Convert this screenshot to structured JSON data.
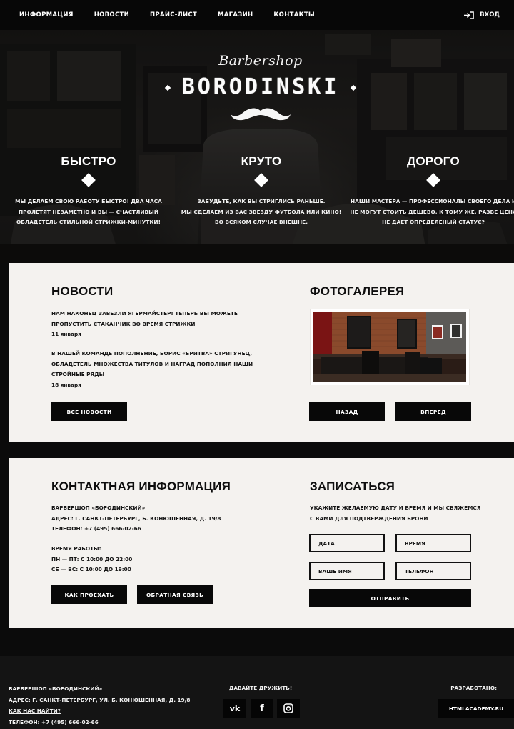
{
  "nav": {
    "items": [
      "ИНФОРМАЦИЯ",
      "НОВОСТИ",
      "ПРАЙС-ЛИСТ",
      "МАГАЗИН",
      "КОНТАКТЫ"
    ],
    "login_label": "ВХОД",
    "login_icon": "login-icon"
  },
  "logo": {
    "script": "Barbershop",
    "wordmark": "BORODINSKI",
    "icon": "mustache-icon"
  },
  "features": [
    {
      "title": "БЫСТРО",
      "lines": [
        "МЫ ДЕЛАЕМ СВОЮ РАБОТУ БЫСТРО! ДВА ЧАСА",
        "ПРОЛЕТЯТ НЕЗАМЕТНО И ВЫ — СЧАСТЛИВЫЙ",
        "ОБЛАДЕТЕЛЬ СТИЛЬНОЙ СТРИЖКИ-МИНУТКИ!"
      ]
    },
    {
      "title": "КРУТО",
      "lines": [
        "ЗАБУДЬТЕ, КАК ВЫ СТРИГЛИСЬ РАНЬШЕ.",
        "МЫ СДЕЛАЕМ ИЗ ВАС ЗВЕЗДУ ФУТБОЛА ИЛИ КИНО!",
        "ВО ВСЯКОМ СЛУЧАЕ ВНЕШНЕ."
      ]
    },
    {
      "title": "ДОРОГО",
      "lines": [
        "НАШИ МАСТЕРА — ПРОФЕССИОНАЛЫ СВОЕГО ДЕЛА И",
        "НЕ МОГУТ СТОИТЬ ДЕШЕВО. К ТОМУ ЖЕ, РАЗВЕ ЦЕНА",
        "НЕ ДАЕТ ОПРЕДЕЛЕНЫЙ СТАТУС?"
      ]
    }
  ],
  "news": {
    "title": "НОВОСТИ",
    "items": [
      {
        "lines": [
          "НАМ НАКОНЕЦ ЗАВЕЗЛИ ЯГЕРМАЙСТЕР! ТЕПЕРЬ ВЫ МОЖЕТЕ",
          "ПРОПУСТИТЬ СТАКАНЧИК ВО ВРЕМЯ СТРИЖКИ"
        ],
        "date": "11 января"
      },
      {
        "lines": [
          "В НАШЕЙ КОМАНДЕ ПОПОЛНЕНИЕ, БОРИС «БРИТВА» СТРИГУНЕЦ,",
          "ОБЛАДЕТЕЛЬ МНОЖЕСТВА ТИТУЛОВ И НАГРАД ПОПОЛНИЛ НАШИ",
          "СТРОЙНЫЕ РЯДЫ"
        ],
        "date": "18 января"
      }
    ],
    "all_button": "ВСЕ НОВОСТИ"
  },
  "gallery": {
    "title": "ФОТОГАЛЕРЕЯ",
    "prev_button": "НАЗАД",
    "next_button": "ВПЕРЕД"
  },
  "contacts": {
    "title": "КОНТАКТНАЯ ИНФОРМАЦИЯ",
    "lines": [
      "БАРБЕРШОП «БОРОДИНСКИЙ»",
      "АДРЕС: Г. САНКТ-ПЕТЕРБУРГ, Б. КОНЮШЕННАЯ, Д. 19/8",
      "ТЕЛЕФОН: +7 (495) 666-02-66"
    ],
    "hours_title": "ВРЕМЯ РАБОТЫ:",
    "hours": [
      "ПН — ПТ: С 10:00 ДО 22:00",
      "СБ — ВС: С 10:00 ДО 19:00"
    ],
    "route_button": "КАК ПРОЕХАТЬ",
    "feedback_button": "ОБРАТНАЯ СВЯЗЬ"
  },
  "booking": {
    "title": "ЗАПИСАТЬСЯ",
    "lines": [
      "УКАЖИТЕ ЖЕЛАЕМУЮ ДАТУ И ВРЕМЯ И МЫ СВЯЖЕМСЯ",
      "С ВАМИ ДЛЯ ПОДТВЕРЖДЕНИЯ БРОНИ"
    ],
    "date_placeholder": "ДАТА",
    "time_placeholder": "ВРЕМЯ",
    "name_placeholder": "ВАШЕ ИМЯ",
    "phone_placeholder": "ТЕЛЕФОН",
    "submit_button": "ОТПРАВИТЬ"
  },
  "footer": {
    "name": "БАРБЕРШОП «БОРОДИНСКИЙ»",
    "address": "АДРЕС: Г. САНКТ-ПЕТЕРБУРГ, УЛ. Б. КОНЮШЕННАЯ, Д. 19/8",
    "directions_link": "КАК НАС НАЙТИ?",
    "phone": "ТЕЛЕФОН: +7 (495) 666-02-66",
    "social_title": "ДАВАЙТЕ ДРУЖИТЬ!",
    "social": [
      {
        "icon": "vk-icon",
        "glyph": "vk"
      },
      {
        "icon": "facebook-icon",
        "glyph": "f"
      },
      {
        "icon": "instagram-icon",
        "glyph": ""
      }
    ],
    "dev_title": "РАЗРАБОТАНО:",
    "dev_button": "HTMLACADEMY.RU"
  }
}
